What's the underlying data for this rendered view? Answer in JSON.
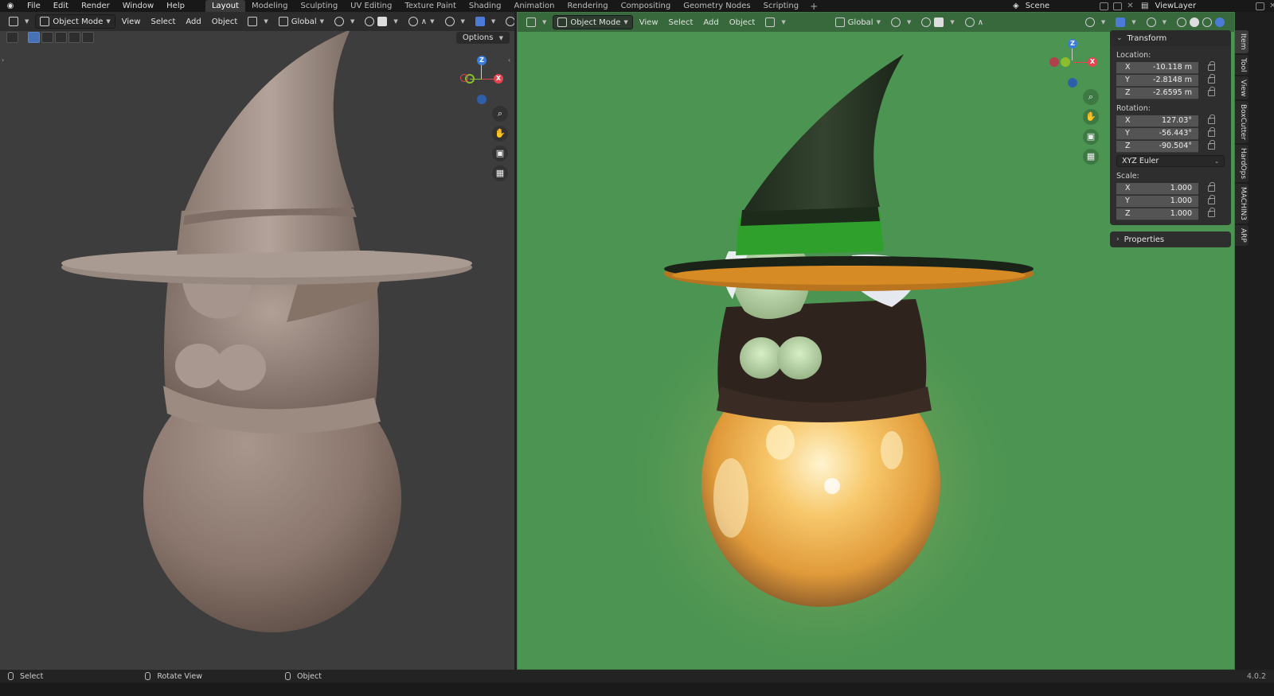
{
  "menu": {
    "items": [
      "File",
      "Edit",
      "Render",
      "Window",
      "Help"
    ]
  },
  "workspaces": {
    "tabs": [
      "Layout",
      "Modeling",
      "Sculpting",
      "UV Editing",
      "Texture Paint",
      "Shading",
      "Animation",
      "Rendering",
      "Compositing",
      "Geometry Nodes",
      "Scripting"
    ],
    "active": "Layout"
  },
  "scene": {
    "name": "Scene"
  },
  "view_layer": {
    "name": "ViewLayer"
  },
  "viewport_left": {
    "mode": "Object Mode",
    "menus": [
      "View",
      "Select",
      "Add",
      "Object"
    ],
    "transform_orientation": "Global",
    "options_label": "Options",
    "background": "#3d3d3d"
  },
  "viewport_right": {
    "mode": "Object Mode",
    "menus": [
      "View",
      "Select",
      "Add",
      "Object"
    ],
    "transform_orientation": "Global",
    "background": "#4b9452"
  },
  "gizmo_axes": {
    "x": "X",
    "y": "Y",
    "z": "Z"
  },
  "axis_colors": {
    "x": "#e8424f",
    "y": "#8bbd2c",
    "z": "#3b7ddd"
  },
  "nav_icons": [
    "zoom-icon",
    "hand-pan-icon",
    "camera-icon",
    "grid-perspective-icon"
  ],
  "transform": {
    "title": "Transform",
    "location_label": "Location:",
    "location": [
      {
        "axis": "X",
        "value": "-10.118 m"
      },
      {
        "axis": "Y",
        "value": "-2.8148 m"
      },
      {
        "axis": "Z",
        "value": "-2.6595 m"
      }
    ],
    "rotation_label": "Rotation:",
    "rotation": [
      {
        "axis": "X",
        "value": "127.03°"
      },
      {
        "axis": "Y",
        "value": "-56.443°"
      },
      {
        "axis": "Z",
        "value": "-90.504°"
      }
    ],
    "rotation_mode": "XYZ Euler",
    "scale_label": "Scale:",
    "scale": [
      {
        "axis": "X",
        "value": "1.000"
      },
      {
        "axis": "Y",
        "value": "1.000"
      },
      {
        "axis": "Z",
        "value": "1.000"
      }
    ]
  },
  "properties": {
    "title": "Properties"
  },
  "sidebar_tabs": [
    "Item",
    "Tool",
    "View",
    "BoxCutter",
    "HardOps",
    "MACHIN3",
    "ARP"
  ],
  "status": {
    "select": "Select",
    "rotate": "Rotate View",
    "object": "Object",
    "version": "4.0.2"
  }
}
